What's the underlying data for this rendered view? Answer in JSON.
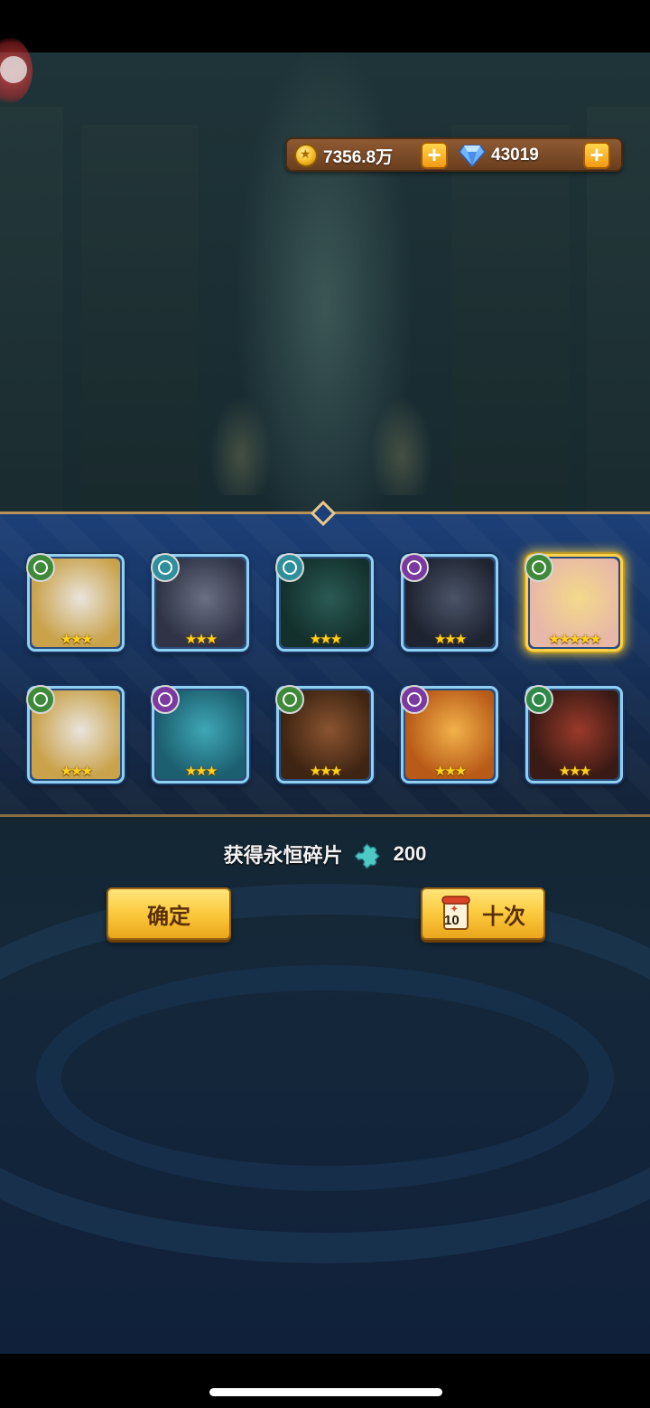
{
  "currency": {
    "gold_value": "7356.8万",
    "gem_value": "43019",
    "gold_icon": "gold-coin-icon",
    "gem_icon": "diamond-icon"
  },
  "heroes": [
    {
      "element": "nature",
      "element_color": "#3f8a3a",
      "stars": "★★★",
      "portrait": "white eagle"
    },
    {
      "element": "wind",
      "element_color": "#2f8f9a",
      "stars": "★★★",
      "portrait": "grey bat creature"
    },
    {
      "element": "wind",
      "element_color": "#2f8f9a",
      "stars": "★★★",
      "portrait": "green goblin"
    },
    {
      "element": "shadow",
      "element_color": "#7a3aa0",
      "stars": "★★★",
      "portrait": "armored knight"
    },
    {
      "element": "nature",
      "element_color": "#3f8a3a",
      "stars": "★★★★★",
      "portrait": "blonde girl",
      "legendary": true
    },
    {
      "element": "nature",
      "element_color": "#3f8a3a",
      "stars": "★★★",
      "portrait": "white eagle"
    },
    {
      "element": "shadow",
      "element_color": "#7a3aa0",
      "stars": "★★★",
      "portrait": "cyan ghost"
    },
    {
      "element": "nature",
      "element_color": "#3f8a3a",
      "stars": "★★★",
      "portrait": "werewolf"
    },
    {
      "element": "shadow",
      "element_color": "#7a3aa0",
      "stars": "★★★",
      "portrait": "fire spirit"
    },
    {
      "element": "light",
      "element_color": "#2f8a4a",
      "stars": "★★★",
      "portrait": "red orc"
    }
  ],
  "reward": {
    "label": "获得永恒碎片",
    "value": "200",
    "icon": "puzzle-piece-icon"
  },
  "buttons": {
    "confirm": "确定",
    "ten_times": "十次",
    "ten_badge": "10"
  },
  "colors": {
    "panel_blue": "#1c3f78",
    "button_gold": "#fbc93d",
    "card_border": "#8fd0f2",
    "legend_border": "#ffd24a"
  }
}
